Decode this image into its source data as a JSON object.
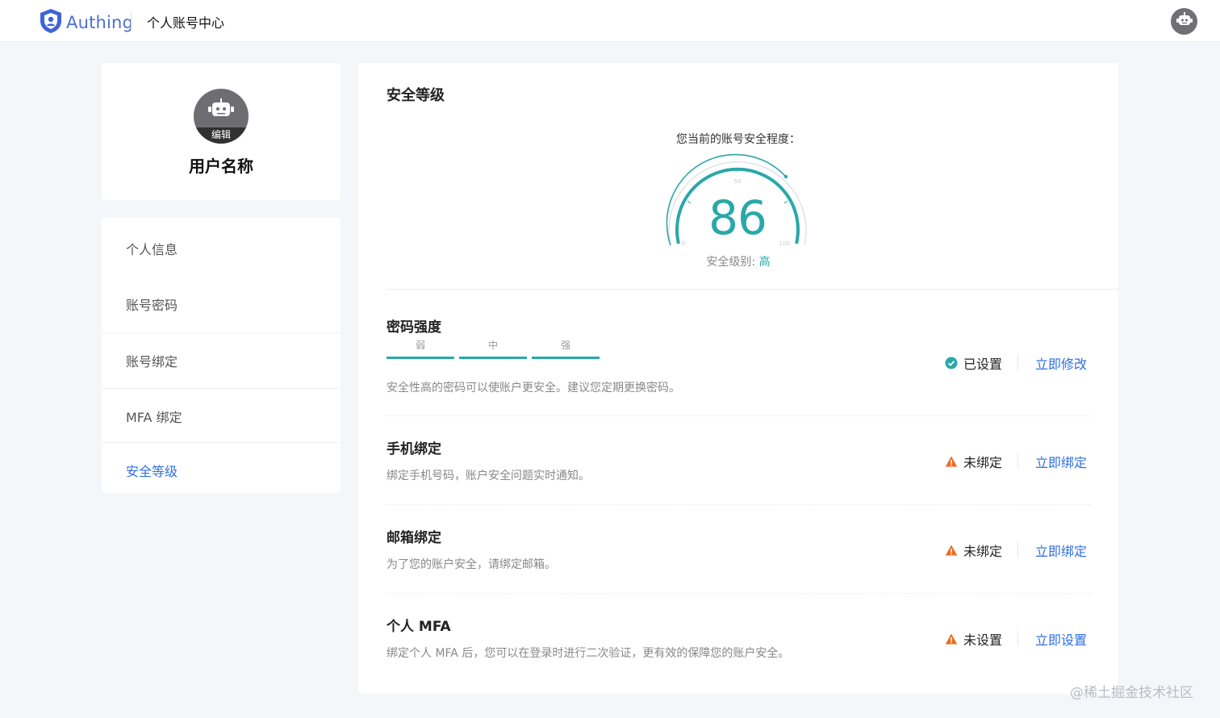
{
  "header": {
    "logo_text": "Authing",
    "title": "个人账号中心",
    "avatar_icon": "robot-avatar-icon"
  },
  "profile": {
    "edit_label": "编辑",
    "username": "用户名称"
  },
  "menu": {
    "items": [
      {
        "label": "个人信息",
        "active": false
      },
      {
        "label": "账号密码",
        "active": false
      },
      {
        "label": "账号绑定",
        "active": false
      },
      {
        "label": "MFA 绑定",
        "active": false
      },
      {
        "label": "安全等级",
        "active": true
      }
    ]
  },
  "main": {
    "title": "安全等级",
    "score_label": "您当前的账号安全程度：",
    "score": "86",
    "gauge_ticks": [
      "0",
      "50",
      "100"
    ],
    "level_prefix": "安全级别:",
    "level_value": "高",
    "sections": [
      {
        "title": "密码强度",
        "strength_labels": [
          "弱",
          "中",
          "强"
        ],
        "description": "安全性高的密码可以使账户更安全。建议您定期更换密码。",
        "status": "已设置",
        "status_icon": "check-circle-icon",
        "action": "立即修改"
      },
      {
        "title": "手机绑定",
        "description": "绑定手机号码，账户安全问题实时通知。",
        "status": "未绑定",
        "status_icon": "warning-icon",
        "action": "立即绑定"
      },
      {
        "title": "邮箱绑定",
        "description": "为了您的账户安全，请绑定邮箱。",
        "status": "未绑定",
        "status_icon": "warning-icon",
        "action": "立即绑定"
      },
      {
        "title": "个人 MFA",
        "description": "绑定个人 MFA 后，您可以在登录时进行二次验证，更有效的保障您的账户安全。",
        "status": "未设置",
        "status_icon": "warning-icon",
        "action": "立即设置"
      }
    ]
  },
  "watermark": "@稀土掘金技术社区",
  "colors": {
    "accent": "#2f6fe0",
    "teal": "#2aa8a8",
    "warning": "#f06a1e",
    "success": "#2aa8a8"
  }
}
